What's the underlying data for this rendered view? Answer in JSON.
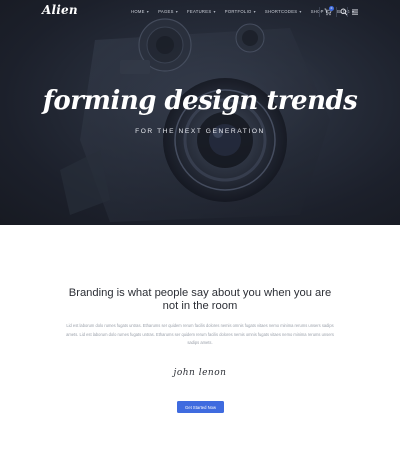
{
  "header": {
    "logo": "Alien",
    "nav": [
      {
        "label": "HOME"
      },
      {
        "label": "PAGES"
      },
      {
        "label": "FEATURES"
      },
      {
        "label": "PORTFOLIO"
      },
      {
        "label": "SHORTCODES"
      },
      {
        "label": "SHOP"
      },
      {
        "label": "BLOG"
      }
    ],
    "cart_count": "0",
    "icons": {
      "cart": "cart-icon",
      "search": "search-icon",
      "menu": "menu-icon",
      "caret": "chevron-down-icon"
    }
  },
  "hero": {
    "title": "forming design trends",
    "subtitle": "FOR THE NEXT GENERATION"
  },
  "content": {
    "quote": "Branding is what people say about you when you are not in the room",
    "body": "Lid est laborum dolo rumes fugats untras. Etharums ser quidem rerum facilis dolores nemis omnis fugats vitaes nemo minima rerums unsers sadips amets. Lid est laborum dolo rumes fugats untras. Etharums ser quidem rerum facilis dolores nemis omnis fugats vitaes nemo minima rerums unsers sadips amets.",
    "signature": "john lenon",
    "cta_label": "Get Started Now"
  },
  "colors": {
    "accent": "#3f6bdf",
    "hero_bg": "#1c202b",
    "text_dark": "#2c2f36",
    "text_muted": "#9aa0aa"
  }
}
